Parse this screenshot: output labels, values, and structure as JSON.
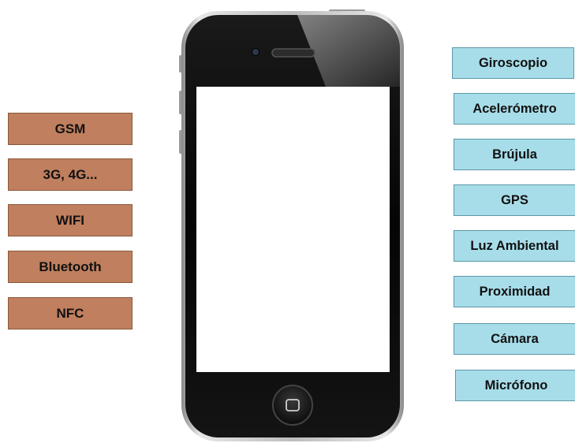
{
  "colors": {
    "connectivity_fill": "#c07f5e",
    "sensor_fill": "#a7dde9",
    "phone_body": "#0a0a0a",
    "phone_bezel": "#c9c9c9",
    "screen": "#ffffff"
  },
  "connectivity": [
    {
      "label": "GSM"
    },
    {
      "label": "3G, 4G..."
    },
    {
      "label": "WIFI"
    },
    {
      "label": "Bluetooth"
    },
    {
      "label": "NFC"
    }
  ],
  "sensors": [
    {
      "label": "Giroscopio"
    },
    {
      "label": "Acelerómetro"
    },
    {
      "label": "Brújula"
    },
    {
      "label": "GPS"
    },
    {
      "label": "Luz Ambiental"
    },
    {
      "label": "Proximidad"
    },
    {
      "label": "Cámara"
    },
    {
      "label": "Micrófono"
    }
  ],
  "phone": {
    "icons": [
      "speaker-grille",
      "front-camera",
      "home-button"
    ]
  }
}
